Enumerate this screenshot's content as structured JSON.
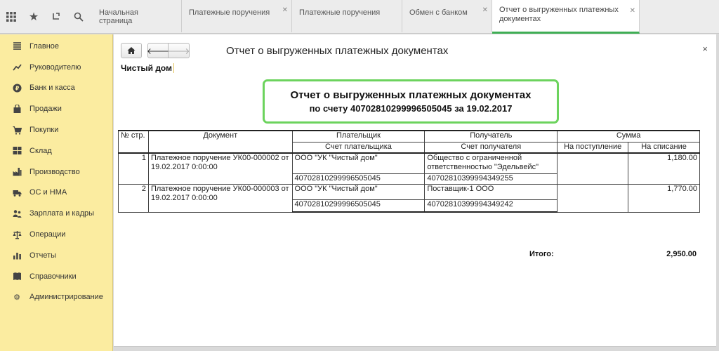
{
  "tabs": [
    {
      "label": "Начальная страница",
      "closable": false
    },
    {
      "label": "Платежные поручения",
      "closable": true
    },
    {
      "label": "Платежные поручения",
      "closable": false
    },
    {
      "label": "Обмен с банком",
      "closable": true
    },
    {
      "label": "Отчет о выгруженных платежных документах",
      "closable": true,
      "active": true
    }
  ],
  "sidebar": {
    "items": [
      {
        "label": "Главное",
        "icon": "menu-lines-icon"
      },
      {
        "label": "Руководителю",
        "icon": "trend-chart-icon"
      },
      {
        "label": "Банк и касса",
        "icon": "ruble-coin-icon"
      },
      {
        "label": "Продажи",
        "icon": "shopping-bag-icon"
      },
      {
        "label": "Покупки",
        "icon": "shopping-cart-icon"
      },
      {
        "label": "Склад",
        "icon": "warehouse-grid-icon"
      },
      {
        "label": "Производство",
        "icon": "factory-icon"
      },
      {
        "label": "ОС и НМА",
        "icon": "truck-icon"
      },
      {
        "label": "Зарплата и кадры",
        "icon": "people-icon"
      },
      {
        "label": "Операции",
        "icon": "scales-icon"
      },
      {
        "label": "Отчеты",
        "icon": "bar-report-icon"
      },
      {
        "label": "Справочники",
        "icon": "book-icon"
      },
      {
        "label": "Администрирование",
        "icon": "gear-icon"
      }
    ]
  },
  "page": {
    "title": "Отчет о выгруженных платежных документах",
    "close_label": "×",
    "organization": "Чистый дом"
  },
  "report": {
    "title": "Отчет о выгруженных платежных документах",
    "subtitle": "по счету  40702810299996505045 за 19.02.2017",
    "headers": {
      "num": "№ стр.",
      "document": "Документ",
      "payer": "Плательщик",
      "payer_account": "Счет плательщика",
      "recipient": "Получатель",
      "recipient_account": "Счет получателя",
      "sum": "Сумма",
      "incoming": "На поступление",
      "outgoing": "На списание"
    },
    "rows": [
      {
        "num": "1",
        "document": "Платежное поручение УК00-000002 от 19.02.2017 0:00:00",
        "payer": "ООО \"УК \"Чистый дом\"",
        "payer_account": "40702810299996505045",
        "recipient": "Общество с ограниченной ответственностью \"Эдельвейс\"",
        "recipient_account": "40702810399994349255",
        "incoming": "",
        "outgoing": "1,180.00"
      },
      {
        "num": "2",
        "document": "Платежное поручение УК00-000003 от 19.02.2017 0:00:00",
        "payer": "ООО \"УК \"Чистый дом\"",
        "payer_account": "40702810299996505045",
        "recipient": "Поставщик-1 ООО",
        "recipient_account": "40702810399994349242",
        "incoming": "",
        "outgoing": "1,770.00"
      }
    ],
    "total_label": "Итого:",
    "total_value": "2,950.00"
  }
}
